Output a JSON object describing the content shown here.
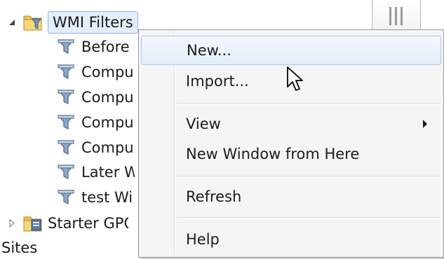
{
  "tree": {
    "root": {
      "label": "WMI Filters",
      "icon": "folder-filter-icon",
      "expanded": true,
      "selected": true
    },
    "children": [
      {
        "label": "Before"
      },
      {
        "label": "Compu"
      },
      {
        "label": "Compu"
      },
      {
        "label": "Compu"
      },
      {
        "label": "Compu"
      },
      {
        "label": "Later W"
      },
      {
        "label": "test Wi"
      }
    ],
    "sibling": {
      "label": "Starter GPO",
      "icon": "folder-gpo-icon",
      "expanded": false
    },
    "sites": {
      "label": "Sites"
    }
  },
  "context_menu": {
    "items": [
      {
        "label": "New...",
        "highlighted": true
      },
      {
        "label": "Import..."
      },
      {
        "label": "View",
        "has_submenu": true
      },
      {
        "label": "New Window from Here"
      },
      {
        "label": "Refresh"
      },
      {
        "label": "Help"
      }
    ]
  },
  "colors": {
    "selection_bg": "#e3eefb",
    "selection_border": "#8fb4de",
    "menu_bg": "#f5f5f5",
    "menu_highlight_border": "#a9c6ea"
  }
}
